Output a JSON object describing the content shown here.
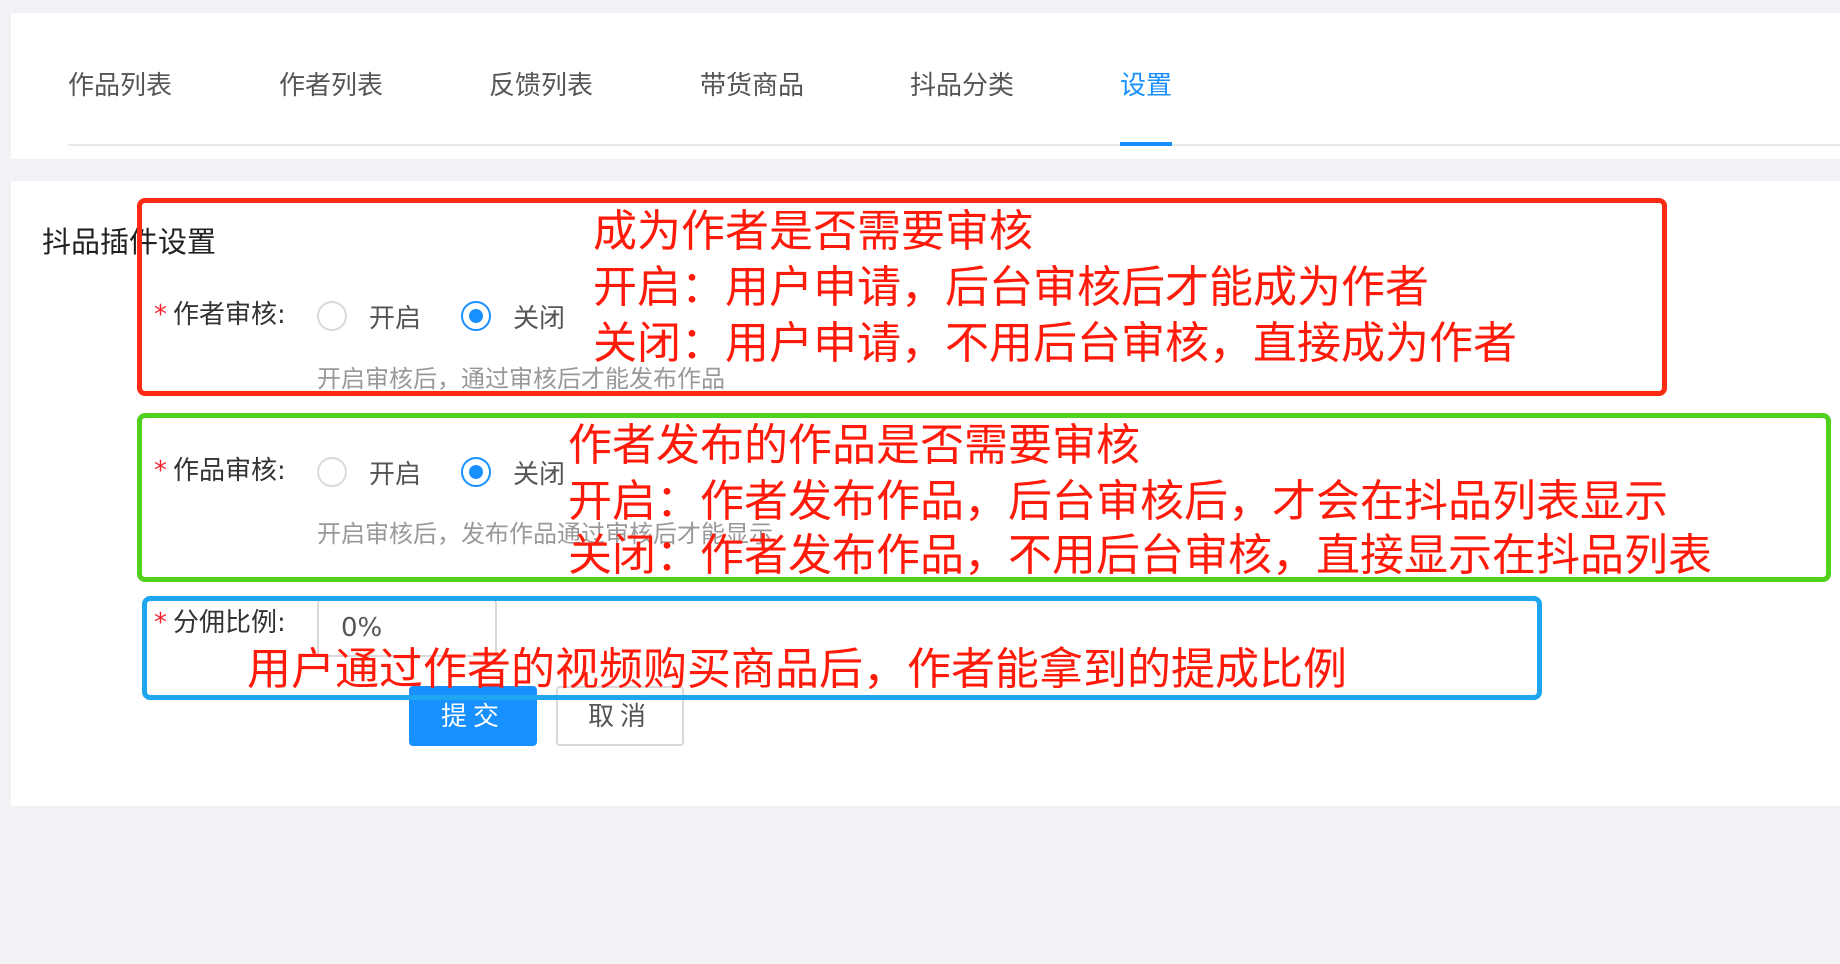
{
  "tabs": [
    {
      "label": "作品列表",
      "active": false
    },
    {
      "label": "作者列表",
      "active": false
    },
    {
      "label": "反馈列表",
      "active": false
    },
    {
      "label": "带货商品",
      "active": false
    },
    {
      "label": "抖品分类",
      "active": false
    },
    {
      "label": "设置",
      "active": true
    }
  ],
  "form": {
    "title": "抖品插件设置",
    "author_review": {
      "label": "作者审核:",
      "options": [
        "开启",
        "关闭"
      ],
      "selected": "关闭",
      "help": "开启审核后，通过审核后才能发布作品"
    },
    "work_review": {
      "label": "作品审核:",
      "options": [
        "开启",
        "关闭"
      ],
      "selected": "关闭",
      "help": "开启审核后，发布作品通过审核后才能显示"
    },
    "commission": {
      "label": "分佣比例:",
      "value": "0%"
    },
    "submit_label": "提交",
    "cancel_label": "取消"
  },
  "annotations": {
    "author": {
      "color": "#ff2a12",
      "lines": [
        "成为作者是否需要审核",
        "开启：用户申请，后台审核后才能成为作者",
        "关闭：用户申请，不用后台审核，直接成为作者"
      ]
    },
    "work": {
      "color": "#52d01e",
      "lines": [
        "作者发布的作品是否需要审核",
        "开启：作者发布作品，后台审核后，才会在抖品列表显示",
        "关闭：作者发布作品，不用后台审核，直接显示在抖品列表"
      ]
    },
    "commission": {
      "color": "#1ea7f0",
      "lines": [
        "用户通过作者的视频购买商品后，作者能拿到的提成比例"
      ]
    }
  },
  "colors": {
    "primary": "#1890ff",
    "required": "#f5222d",
    "annotation_text": "#ff1a0a"
  }
}
